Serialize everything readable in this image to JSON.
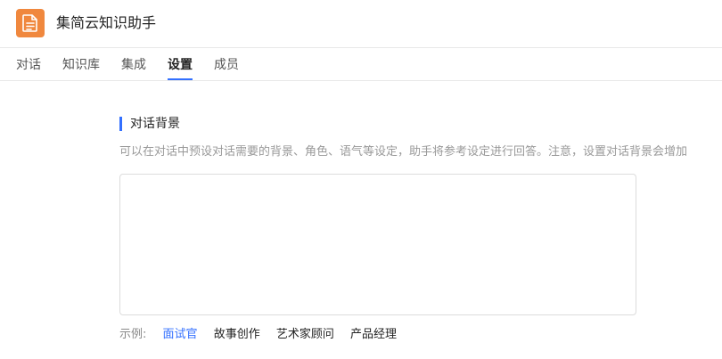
{
  "app": {
    "title": "集简云知识助手",
    "logo_icon": "document-icon",
    "logo_color": "#f0883e"
  },
  "tabs": [
    {
      "label": "对话",
      "active": false
    },
    {
      "label": "知识库",
      "active": false
    },
    {
      "label": "集成",
      "active": false
    },
    {
      "label": "设置",
      "active": true
    },
    {
      "label": "成员",
      "active": false
    }
  ],
  "accent_color": "#3370ff",
  "section": {
    "title": "对话背景",
    "description": "可以在对话中预设对话需要的背景、角色、语气等设定，助手将参考设定进行回答。注意，设置对话背景会增加",
    "textarea_value": ""
  },
  "examples": {
    "label": "示例:",
    "items": [
      {
        "label": "面试官",
        "selected": true
      },
      {
        "label": "故事创作",
        "selected": false
      },
      {
        "label": "艺术家顾问",
        "selected": false
      },
      {
        "label": "产品经理",
        "selected": false
      }
    ]
  }
}
